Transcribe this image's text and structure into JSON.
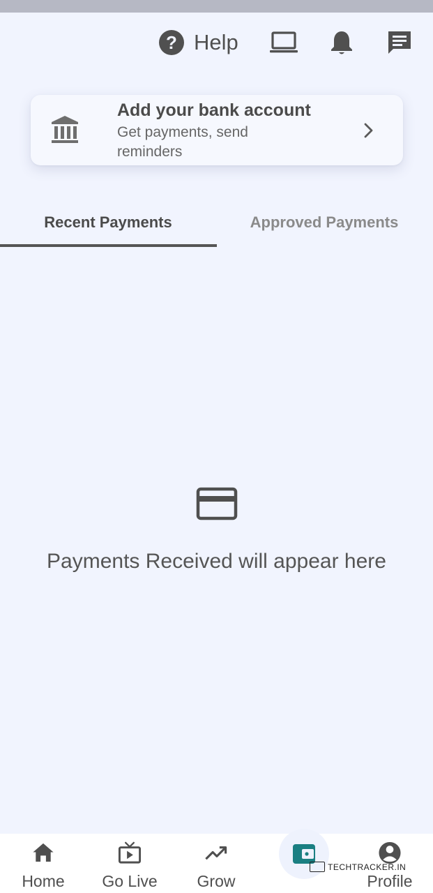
{
  "header": {
    "help_label": "Help",
    "icons": [
      "help-icon",
      "laptop-icon",
      "bell-icon",
      "message-icon"
    ]
  },
  "bank_card": {
    "title": "Add your bank account",
    "subtitle": "Get payments, send reminders",
    "icon": "bank-icon"
  },
  "tabs": [
    {
      "label": "Recent Payments",
      "active": true
    },
    {
      "label": "Approved Payments",
      "active": false
    }
  ],
  "empty_state": {
    "icon": "credit-card-icon",
    "message": "Payments Received will appear here"
  },
  "bottom_nav": {
    "items": [
      {
        "label": "Home",
        "icon": "home-icon"
      },
      {
        "label": "Go Live",
        "icon": "tv-play-icon"
      },
      {
        "label": "Grow",
        "icon": "trending-up-icon"
      },
      {
        "label": "",
        "icon": "wallet-icon",
        "active": true
      },
      {
        "label": "Profile",
        "icon": "account-circle-icon"
      }
    ],
    "active_color": "#1a7f82"
  },
  "watermark": "TECHTRACKER.IN"
}
